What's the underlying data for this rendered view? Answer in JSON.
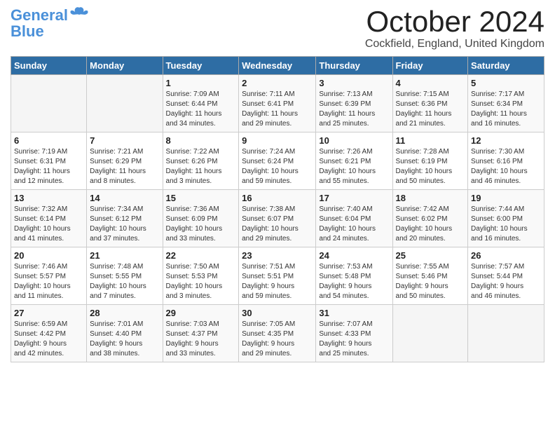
{
  "header": {
    "logo_line1": "General",
    "logo_line2": "Blue",
    "month_title": "October 2024",
    "location": "Cockfield, England, United Kingdom"
  },
  "days_of_week": [
    "Sunday",
    "Monday",
    "Tuesday",
    "Wednesday",
    "Thursday",
    "Friday",
    "Saturday"
  ],
  "weeks": [
    [
      {
        "day": "",
        "content": ""
      },
      {
        "day": "",
        "content": ""
      },
      {
        "day": "1",
        "content": "Sunrise: 7:09 AM\nSunset: 6:44 PM\nDaylight: 11 hours\nand 34 minutes."
      },
      {
        "day": "2",
        "content": "Sunrise: 7:11 AM\nSunset: 6:41 PM\nDaylight: 11 hours\nand 29 minutes."
      },
      {
        "day": "3",
        "content": "Sunrise: 7:13 AM\nSunset: 6:39 PM\nDaylight: 11 hours\nand 25 minutes."
      },
      {
        "day": "4",
        "content": "Sunrise: 7:15 AM\nSunset: 6:36 PM\nDaylight: 11 hours\nand 21 minutes."
      },
      {
        "day": "5",
        "content": "Sunrise: 7:17 AM\nSunset: 6:34 PM\nDaylight: 11 hours\nand 16 minutes."
      }
    ],
    [
      {
        "day": "6",
        "content": "Sunrise: 7:19 AM\nSunset: 6:31 PM\nDaylight: 11 hours\nand 12 minutes."
      },
      {
        "day": "7",
        "content": "Sunrise: 7:21 AM\nSunset: 6:29 PM\nDaylight: 11 hours\nand 8 minutes."
      },
      {
        "day": "8",
        "content": "Sunrise: 7:22 AM\nSunset: 6:26 PM\nDaylight: 11 hours\nand 3 minutes."
      },
      {
        "day": "9",
        "content": "Sunrise: 7:24 AM\nSunset: 6:24 PM\nDaylight: 10 hours\nand 59 minutes."
      },
      {
        "day": "10",
        "content": "Sunrise: 7:26 AM\nSunset: 6:21 PM\nDaylight: 10 hours\nand 55 minutes."
      },
      {
        "day": "11",
        "content": "Sunrise: 7:28 AM\nSunset: 6:19 PM\nDaylight: 10 hours\nand 50 minutes."
      },
      {
        "day": "12",
        "content": "Sunrise: 7:30 AM\nSunset: 6:16 PM\nDaylight: 10 hours\nand 46 minutes."
      }
    ],
    [
      {
        "day": "13",
        "content": "Sunrise: 7:32 AM\nSunset: 6:14 PM\nDaylight: 10 hours\nand 41 minutes."
      },
      {
        "day": "14",
        "content": "Sunrise: 7:34 AM\nSunset: 6:12 PM\nDaylight: 10 hours\nand 37 minutes."
      },
      {
        "day": "15",
        "content": "Sunrise: 7:36 AM\nSunset: 6:09 PM\nDaylight: 10 hours\nand 33 minutes."
      },
      {
        "day": "16",
        "content": "Sunrise: 7:38 AM\nSunset: 6:07 PM\nDaylight: 10 hours\nand 29 minutes."
      },
      {
        "day": "17",
        "content": "Sunrise: 7:40 AM\nSunset: 6:04 PM\nDaylight: 10 hours\nand 24 minutes."
      },
      {
        "day": "18",
        "content": "Sunrise: 7:42 AM\nSunset: 6:02 PM\nDaylight: 10 hours\nand 20 minutes."
      },
      {
        "day": "19",
        "content": "Sunrise: 7:44 AM\nSunset: 6:00 PM\nDaylight: 10 hours\nand 16 minutes."
      }
    ],
    [
      {
        "day": "20",
        "content": "Sunrise: 7:46 AM\nSunset: 5:57 PM\nDaylight: 10 hours\nand 11 minutes."
      },
      {
        "day": "21",
        "content": "Sunrise: 7:48 AM\nSunset: 5:55 PM\nDaylight: 10 hours\nand 7 minutes."
      },
      {
        "day": "22",
        "content": "Sunrise: 7:50 AM\nSunset: 5:53 PM\nDaylight: 10 hours\nand 3 minutes."
      },
      {
        "day": "23",
        "content": "Sunrise: 7:51 AM\nSunset: 5:51 PM\nDaylight: 9 hours\nand 59 minutes."
      },
      {
        "day": "24",
        "content": "Sunrise: 7:53 AM\nSunset: 5:48 PM\nDaylight: 9 hours\nand 54 minutes."
      },
      {
        "day": "25",
        "content": "Sunrise: 7:55 AM\nSunset: 5:46 PM\nDaylight: 9 hours\nand 50 minutes."
      },
      {
        "day": "26",
        "content": "Sunrise: 7:57 AM\nSunset: 5:44 PM\nDaylight: 9 hours\nand 46 minutes."
      }
    ],
    [
      {
        "day": "27",
        "content": "Sunrise: 6:59 AM\nSunset: 4:42 PM\nDaylight: 9 hours\nand 42 minutes."
      },
      {
        "day": "28",
        "content": "Sunrise: 7:01 AM\nSunset: 4:40 PM\nDaylight: 9 hours\nand 38 minutes."
      },
      {
        "day": "29",
        "content": "Sunrise: 7:03 AM\nSunset: 4:37 PM\nDaylight: 9 hours\nand 33 minutes."
      },
      {
        "day": "30",
        "content": "Sunrise: 7:05 AM\nSunset: 4:35 PM\nDaylight: 9 hours\nand 29 minutes."
      },
      {
        "day": "31",
        "content": "Sunrise: 7:07 AM\nSunset: 4:33 PM\nDaylight: 9 hours\nand 25 minutes."
      },
      {
        "day": "",
        "content": ""
      },
      {
        "day": "",
        "content": ""
      }
    ]
  ]
}
